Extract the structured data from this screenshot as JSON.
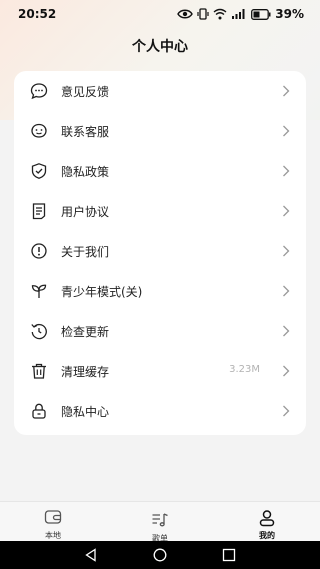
{
  "status_bar": {
    "time": "20:52",
    "battery": "39%"
  },
  "header": {
    "title": "个人中心"
  },
  "menu": [
    {
      "label": "意见反馈",
      "icon": "chat-bubble-icon"
    },
    {
      "label": "联系客服",
      "icon": "customer-service-icon"
    },
    {
      "label": "隐私政策",
      "icon": "shield-check-icon"
    },
    {
      "label": "用户协议",
      "icon": "document-icon"
    },
    {
      "label": "关于我们",
      "icon": "info-icon"
    },
    {
      "label": "青少年模式(关)",
      "icon": "sprout-icon"
    },
    {
      "label": "检查更新",
      "icon": "refresh-icon"
    },
    {
      "label": "清理缓存",
      "icon": "trash-icon",
      "value": "3.23M"
    },
    {
      "label": "隐私中心",
      "icon": "lock-icon"
    }
  ],
  "bottom_nav": [
    {
      "label": "本地",
      "icon": "wallet-icon"
    },
    {
      "label": "歌单",
      "icon": "playlist-icon"
    },
    {
      "label": "我的",
      "icon": "user-icon",
      "active": true
    }
  ],
  "colors": {
    "card_bg": "#ffffff",
    "page_bg": "#f3f3f3",
    "text": "#222222",
    "muted": "#b3b3b3"
  }
}
